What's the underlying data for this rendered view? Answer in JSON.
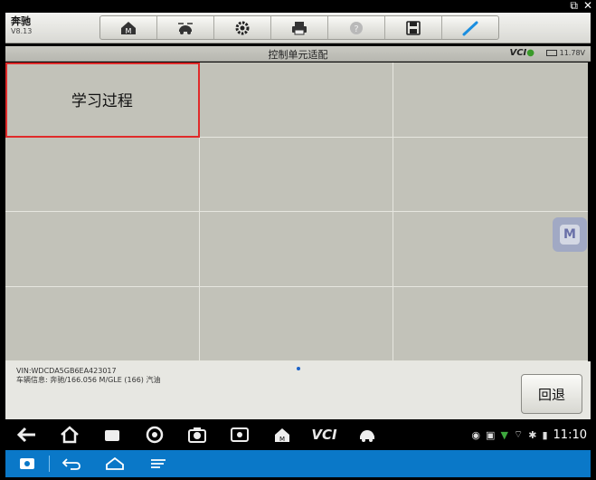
{
  "brand": {
    "name": "奔驰",
    "version": "V8.13"
  },
  "titlebar": {
    "title": "控制单元适配",
    "vci_label": "VCI",
    "battery": "11.78V"
  },
  "grid": {
    "cells": [
      "学习过程",
      "",
      "",
      "",
      "",
      "",
      "",
      "",
      "",
      "",
      "",
      ""
    ],
    "selected_index": 0
  },
  "info": {
    "vin": "VIN:WDCDA5GB6EA423017",
    "vehicle": "车辆信息: 奔驰/166.056 M/GLE (166) 汽油"
  },
  "buttons": {
    "back": "回退"
  },
  "navbar": {
    "vci_label": "VCI"
  },
  "status": {
    "time": "11:10"
  },
  "float_button": {
    "label": "M"
  },
  "colors": {
    "selection": "#e02a2a",
    "subbar": "#0a78c8",
    "vci_dot": "#3a9a2a"
  }
}
